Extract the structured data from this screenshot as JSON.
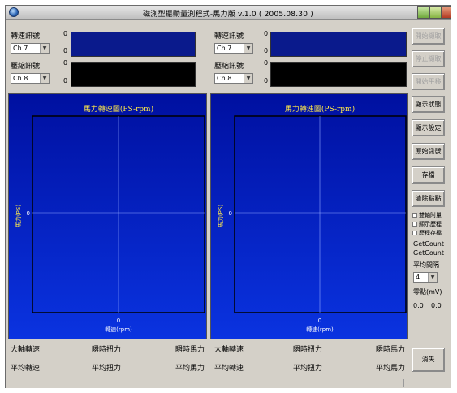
{
  "window": {
    "title": "磁測型擺動量測程式-馬力版 v.1.0 ( 2005.08.30 )"
  },
  "left_panel": {
    "speed_signal_label": "轉速訊號",
    "speed_channel": "Ch 7",
    "pressure_signal_label": "壓縮訊號",
    "pressure_channel": "Ch 8",
    "zero": "0",
    "chart": {
      "title": "馬力轉速圖(PS-rpm)",
      "ylabel": "馬力(PS)",
      "xlabel": "轉速(rpm)",
      "x_tick": "0",
      "y_tick": "0"
    }
  },
  "right_panel": {
    "speed_signal_label": "轉速訊號",
    "speed_channel": "Ch 7",
    "pressure_signal_label": "壓縮訊號",
    "pressure_channel": "Ch 8",
    "zero": "0",
    "chart": {
      "title": "馬力轉速圖(PS-rpm)",
      "ylabel": "馬力(PS)",
      "xlabel": "轉速(rpm)",
      "x_tick": "0",
      "y_tick": "0"
    }
  },
  "stats": {
    "max_speed": "大軸轉速",
    "instant_torque": "瞬時扭力",
    "instant_power": "瞬時馬力",
    "avg_speed": "平均轉速",
    "avg_torque": "平均扭力",
    "avg_power": "平均馬力"
  },
  "sidebar": {
    "buttons": [
      {
        "label": "開始擷取",
        "enabled": false
      },
      {
        "label": "停止擷取",
        "enabled": false
      },
      {
        "label": "開始平移",
        "enabled": false
      },
      {
        "label": "顯示狀態",
        "enabled": true
      },
      {
        "label": "顯示設定",
        "enabled": true
      },
      {
        "label": "原始訊號",
        "enabled": true
      },
      {
        "label": "存檔",
        "enabled": true
      },
      {
        "label": "清除點點",
        "enabled": true
      }
    ],
    "checkboxes": [
      "雙軸附量",
      "顯示歷程",
      "歷程存檔"
    ],
    "get_count_1": "GetCount",
    "get_count_2": "GetCount",
    "avg_interval_label": "平均間隔",
    "avg_interval_value": "4",
    "zero_point_label": "零點(mV)",
    "zero_value_1": "0.0",
    "zero_value_2": "0.0",
    "exit_label": "消失"
  }
}
